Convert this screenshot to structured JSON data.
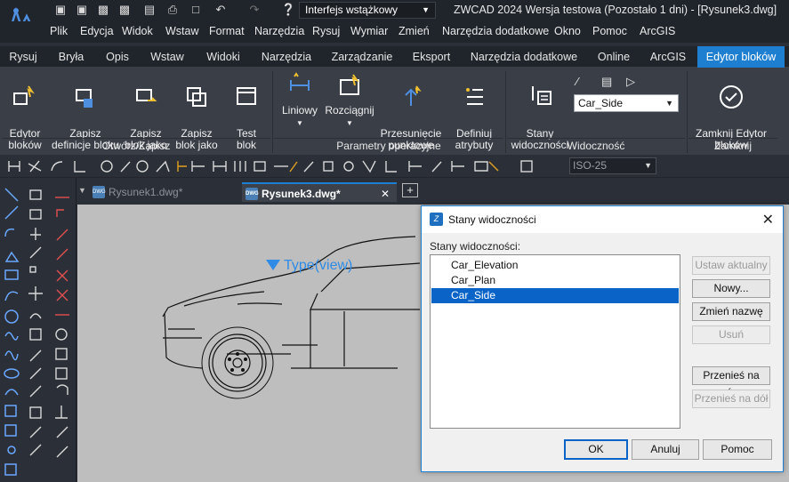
{
  "titlebar": {
    "workspace": "Interfejs wstążkowy",
    "title": "ZWCAD 2024 Wersja testowa (Pozostało 1 dni) - [Rysunek3.dwg]"
  },
  "menu": [
    "Plik",
    "Edycja",
    "Widok",
    "Wstaw",
    "Format",
    "Narzędzia",
    "Rysuj",
    "Wymiar",
    "Zmień",
    "Narzędzia dodatkowe",
    "Okno",
    "Pomoc",
    "ArcGIS"
  ],
  "ribbon_tabs": [
    "Rysuj",
    "Bryła",
    "Opis",
    "Wstaw",
    "Widoki",
    "Narzędzia",
    "Zarządzanie",
    "Eksport",
    "Narzędzia dodatkowe",
    "Online",
    "ArcGIS",
    "Edytor bloków"
  ],
  "ribbon": {
    "buttons": {
      "edytor": "Edytor\nbloków",
      "zapisz_def": "Zapisz\ndefinicje bloku",
      "zapisz_blok1": "Zapisz\nblok jako",
      "zapisz_blok2": "Zapisz\nblok jako",
      "test": "Test\nblok",
      "liniowy": "Liniowy",
      "rozciagnij": "Rozciągnij",
      "przesuniecie": "Przesunięcie\npunktowe",
      "definiuj": "Definiuj\natrybuty",
      "stany": "Stany\nwidoczności",
      "zamknij": "Zamknij Edytor\nbloków"
    },
    "visibility_state": "Car_Side",
    "groups": {
      "otworz": "Otwórz/Zapisz",
      "parametry": "Parametry operacyjne",
      "widocznosc": "Widoczność",
      "zamknij": "Zamknij"
    }
  },
  "toolrow": {
    "dimstyle": "ISO-25"
  },
  "doc_tabs": [
    "Rysunek1.dwg*",
    "Rysunek3.dwg*"
  ],
  "canvas": {
    "annotation": "Type(view)"
  },
  "dialog": {
    "title": "Stany widoczności",
    "list_label": "Stany widoczności:",
    "states": [
      {
        "name": "Car_Elevation",
        "selected": false
      },
      {
        "name": "Car_Plan",
        "selected": false
      },
      {
        "name": "Car_Side",
        "selected": true
      }
    ],
    "buttons": {
      "ustaw": "Ustaw aktualny",
      "nowy": "Nowy...",
      "zmien": "Zmień nazwę",
      "usun": "Usuń",
      "gora": "Przenieś na górę",
      "dol": "Przenieś na dół",
      "ok": "OK",
      "anuluj": "Anuluj",
      "pomoc": "Pomoc"
    }
  },
  "colors": {
    "accent": "#1e7fd0",
    "ribbon": "#3a3f47",
    "canvas": "#bebebe",
    "selection": "#0a64c8"
  }
}
